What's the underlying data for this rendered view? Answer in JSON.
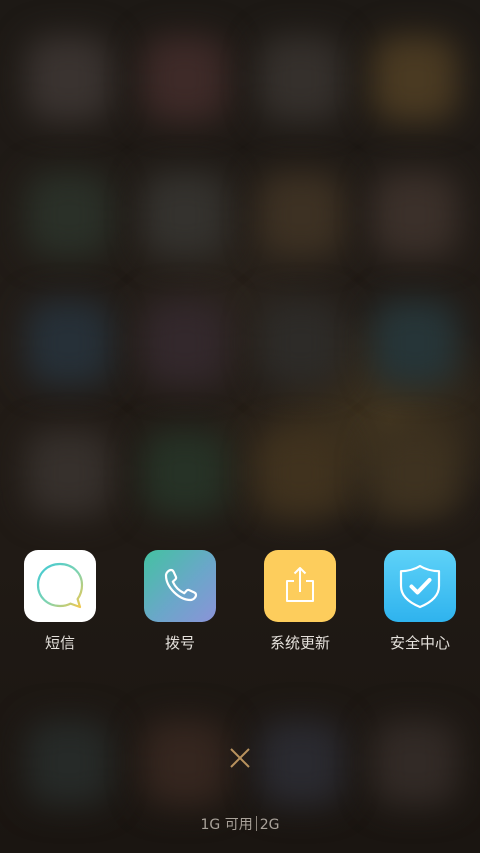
{
  "apps": [
    {
      "label": "短信",
      "icon": "message-bubble-icon",
      "colors": {
        "background": "#ffffff",
        "ring_start": "#3fc9d6",
        "ring_end": "#f6c84a"
      }
    },
    {
      "label": "拨号",
      "icon": "phone-handset-icon",
      "colors": {
        "gradient_start": "#43c2a1",
        "gradient_end": "#8b93d8"
      }
    },
    {
      "label": "系统更新",
      "icon": "share-upload-icon",
      "colors": {
        "background": "#fdcd5c"
      }
    },
    {
      "label": "安全中心",
      "icon": "shield-check-icon",
      "colors": {
        "gradient_start": "#5ed2f8",
        "gradient_end": "#2fb3ee"
      }
    }
  ],
  "close_icon": "close-icon",
  "memory": {
    "available": "1G 可用",
    "total": "2G"
  }
}
